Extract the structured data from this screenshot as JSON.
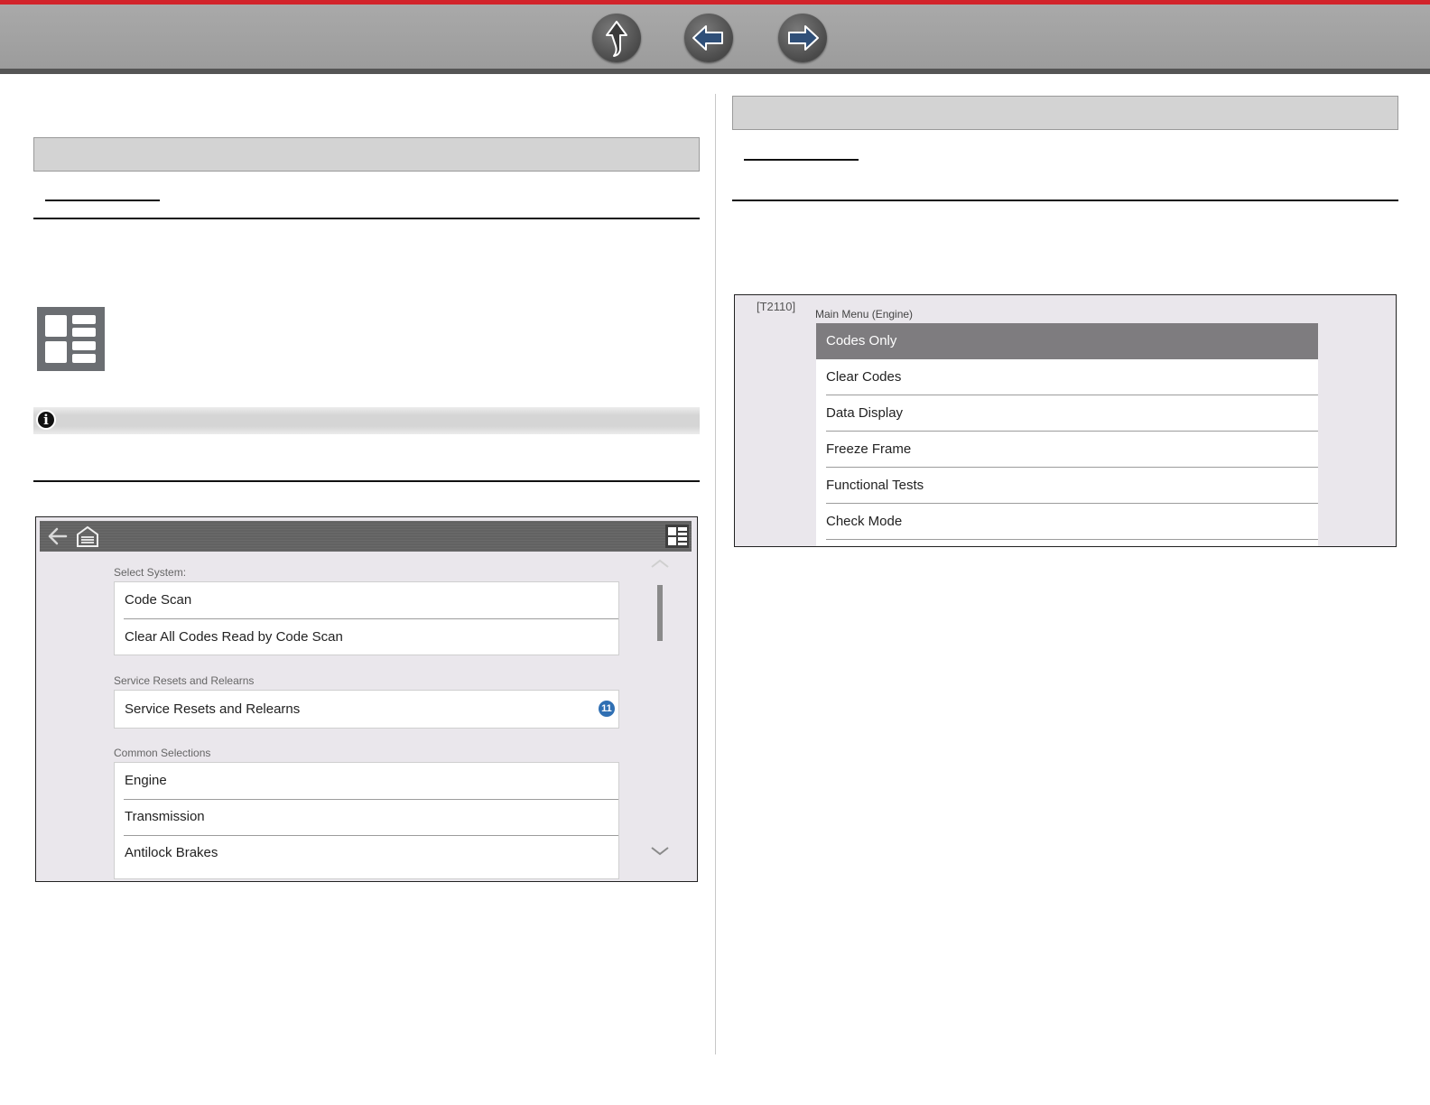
{
  "nav": {
    "up_icon": "up-arrow-icon",
    "back_icon": "left-arrow-icon",
    "forward_icon": "right-arrow-icon"
  },
  "colors": {
    "accent_top": "#d2232a",
    "toolbar_gray": "#a3a3a3",
    "selected_row": "#7e7c7f",
    "badge_blue": "#2f6fb3"
  },
  "main_screen": {
    "toolbar_icons": [
      "back-arrow-icon",
      "home-garage-icon",
      "view-toggle-icon"
    ],
    "sections": [
      {
        "label": "Select System:",
        "items": [
          "Code Scan",
          "Clear All Codes Read by Code Scan"
        ]
      },
      {
        "label": "Service Resets and Relearns",
        "items": [
          "Service Resets and Relearns"
        ],
        "badge": "11"
      },
      {
        "label": "Common Selections",
        "items": [
          "Engine",
          "Transmission",
          "Antilock Brakes"
        ]
      }
    ]
  },
  "menu_screen": {
    "tag": "[T2110]",
    "title": "Main Menu (Engine)",
    "items": [
      "Codes Only",
      "Clear Codes",
      "Data Display",
      "Freeze Frame",
      "Functional Tests",
      "Check Mode"
    ],
    "selected_index": 0
  }
}
